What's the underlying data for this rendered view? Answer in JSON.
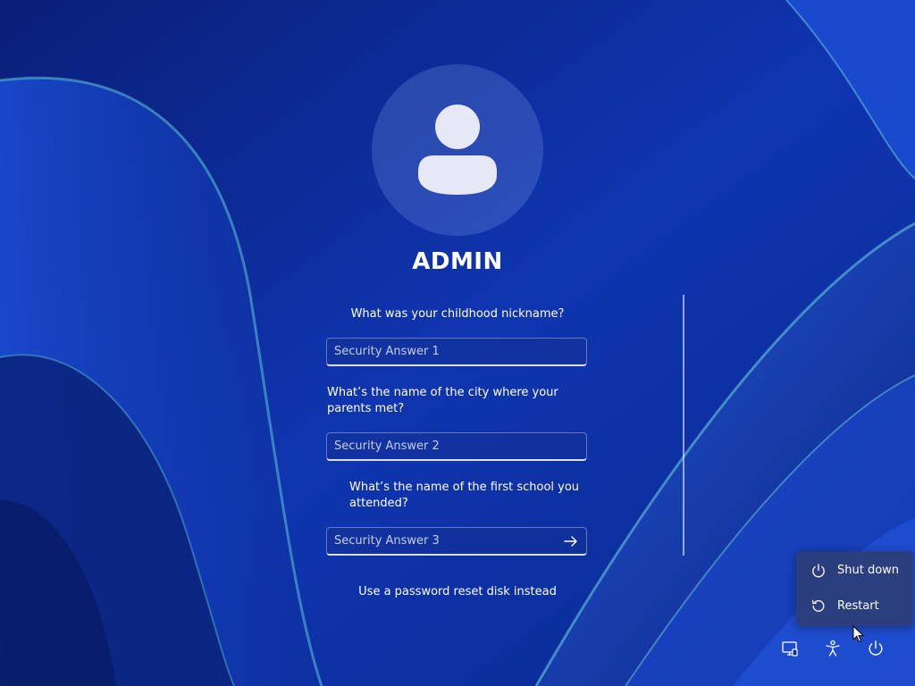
{
  "user": {
    "name": "ADMIN"
  },
  "security": {
    "question_1": "What was your childhood nickname?",
    "answer_1_placeholder": "Security Answer 1",
    "answer_1_value": "",
    "question_2": "What’s the name of the city where your parents met?",
    "answer_2_placeholder": "Security Answer 2",
    "answer_2_value": "",
    "question_3": "What’s the name of the first school you attended?",
    "answer_3_placeholder": "Security Answer 3",
    "answer_3_value": "",
    "reset_disk_link": "Use a password reset disk instead"
  },
  "power_menu": {
    "items": [
      {
        "label": "Shut down",
        "icon": "power-icon"
      },
      {
        "label": "Restart",
        "icon": "restart-icon"
      }
    ]
  },
  "taskbar_icons": [
    "network-icon",
    "accessibility-icon",
    "power-icon"
  ],
  "colors": {
    "background": "#0c2a8c",
    "accent": "#ffffff",
    "menu_background": "#2c3e78"
  }
}
